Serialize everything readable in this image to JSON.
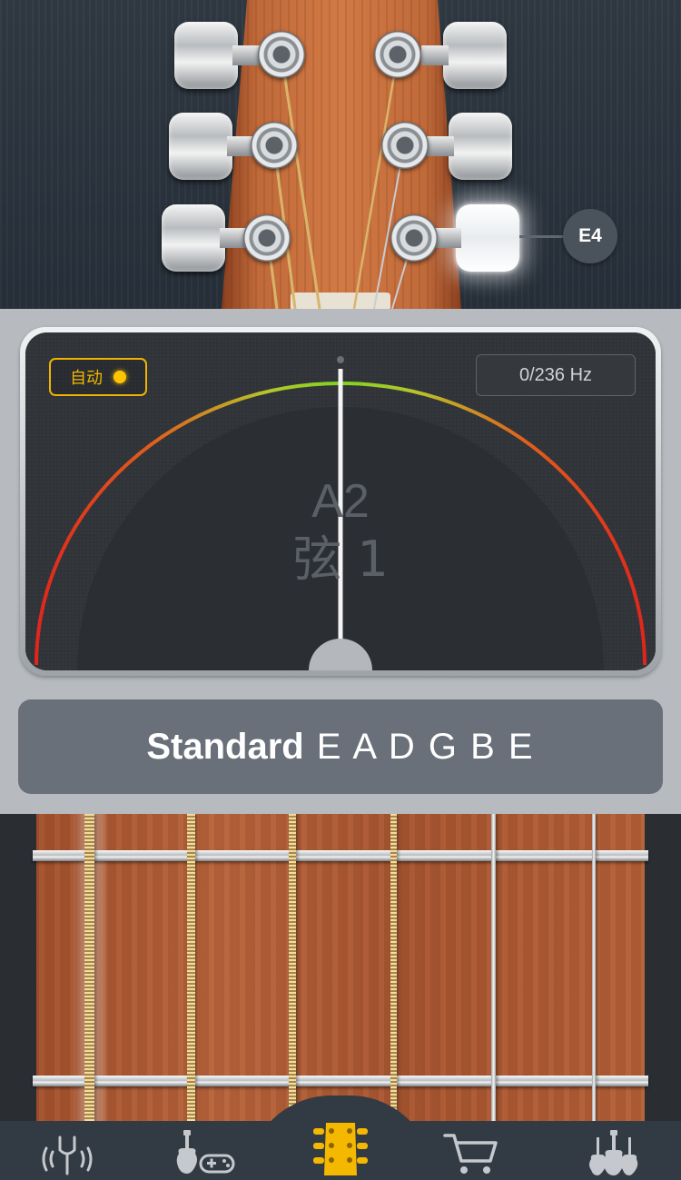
{
  "headstock": {
    "active_note": "E4"
  },
  "tuner": {
    "mode_label": "自动",
    "frequency": "0/236 Hz",
    "note": "A2",
    "string_label": "弦 1"
  },
  "tuning": {
    "name": "Standard",
    "notes": "E A D G B E"
  },
  "nav": {
    "items": [
      {
        "icon": "tuning-fork-icon"
      },
      {
        "icon": "guitar-game-icon"
      },
      {
        "icon": "headstock-tuner-icon",
        "active": true
      },
      {
        "icon": "cart-icon"
      },
      {
        "icon": "guitars-icon"
      }
    ]
  },
  "colors": {
    "accent": "#f5b800",
    "gauge_in_tune": "#7ed321",
    "gauge_out_of_tune": "#e0261c"
  }
}
